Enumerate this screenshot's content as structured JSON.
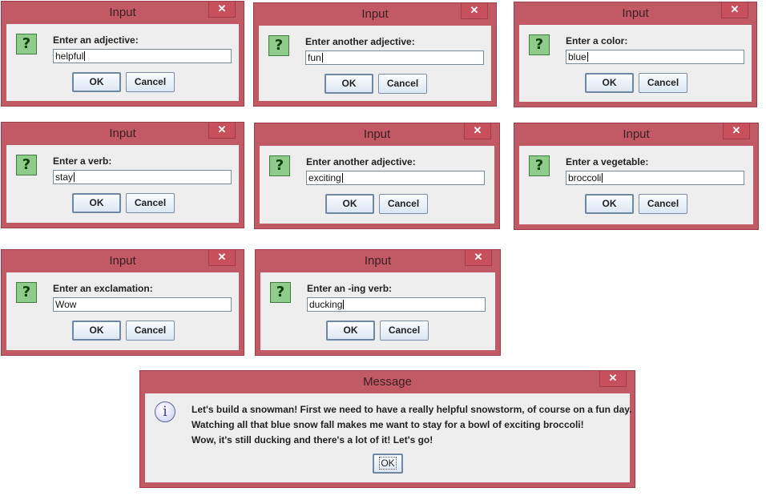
{
  "dialogs": [
    {
      "title": "Input",
      "prompt": "Enter an adjective:",
      "value": "helpful",
      "ok": "OK",
      "cancel": "Cancel"
    },
    {
      "title": "Input",
      "prompt": "Enter another adjective:",
      "value": "fun",
      "ok": "OK",
      "cancel": "Cancel"
    },
    {
      "title": "Input",
      "prompt": "Enter a color:",
      "value": "blue",
      "ok": "OK",
      "cancel": "Cancel"
    },
    {
      "title": "Input",
      "prompt": "Enter a verb:",
      "value": "stay",
      "ok": "OK",
      "cancel": "Cancel"
    },
    {
      "title": "Input",
      "prompt": "Enter another adjective:",
      "value": "exciting",
      "ok": "OK",
      "cancel": "Cancel"
    },
    {
      "title": "Input",
      "prompt": "Enter a vegetable:",
      "value": "broccoli",
      "ok": "OK",
      "cancel": "Cancel"
    },
    {
      "title": "Input",
      "prompt": "Enter an exclamation:",
      "value": "Wow",
      "ok": "OK",
      "cancel": "Cancel"
    },
    {
      "title": "Input",
      "prompt": "Enter an -ing verb:",
      "value": "ducking",
      "ok": "OK",
      "cancel": "Cancel"
    }
  ],
  "message": {
    "title": "Message",
    "lines": [
      "Let's build a snowman! First we need to have a really helpful snowstorm, of course on a fun day.",
      "Watching all that blue snow fall makes me want to stay for a bowl of exciting broccoli!",
      "Wow, it's still ducking and there's a lot of it! Let's go!"
    ],
    "ok": "OK"
  },
  "icons": {
    "close": "✕",
    "question": "?",
    "info": "i"
  },
  "colors": {
    "frame": "#c25a65",
    "close_button": "#c7505d",
    "dialog_body": "#eeeeee",
    "question_icon": "#8fcb8b",
    "button_gradient_bottom": "#dce7f3"
  }
}
